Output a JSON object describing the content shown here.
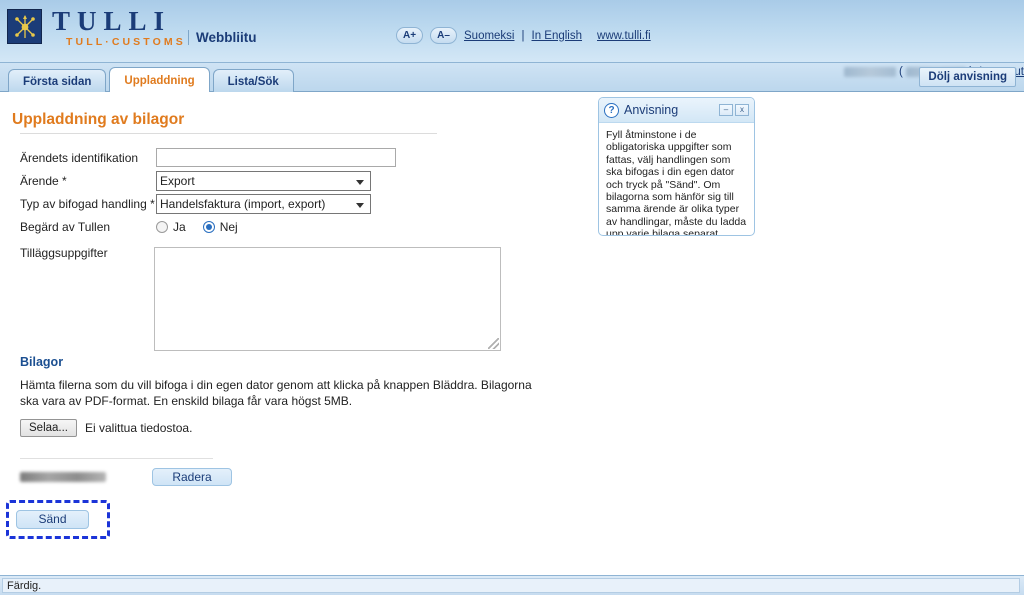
{
  "header": {
    "brand_main": "TULLI",
    "brand_sub": "TULL·CUSTOMS",
    "app_name": "Webbliitu",
    "font_increase": "A+",
    "font_decrease": "A–",
    "lang_fi": "Suomeksi",
    "lang_sep": "|",
    "lang_en": "In English",
    "site_link": "www.tulli.fi"
  },
  "tabs": [
    {
      "label": "Första sidan",
      "active": false
    },
    {
      "label": "Uppladdning",
      "active": true
    },
    {
      "label": "Lista/Sök",
      "active": false
    }
  ],
  "userbar": {
    "open_paren": "(",
    "close_paren": ")",
    "logout": "Logga ut",
    "hide_hint": "Dölj anvisning"
  },
  "page": {
    "title": "Uppladdning av bilagor"
  },
  "form": {
    "fields": [
      {
        "label": "Ärendets identifikation",
        "value": "",
        "type": "text"
      },
      {
        "label": "Ärende *",
        "value": "Export",
        "type": "select"
      },
      {
        "label": "Typ av bifogad handling *",
        "value": "Handelsfaktura (import, export)",
        "type": "select"
      }
    ],
    "radio_label": "Begärd av Tullen",
    "radio_yes": "Ja",
    "radio_no": "Nej",
    "radio_selected": "Nej",
    "textarea_label": "Tilläggsuppgifter",
    "textarea_value": ""
  },
  "attachments": {
    "section_title": "Bilagor",
    "description": "Hämta filerna som du vill bifoga i din egen dator genom att klicka på knappen Bläddra. Bilagorna ska vara av PDF-format. En enskild bilaga får vara högst 5MB.",
    "browse_button": "Selaa...",
    "no_file_text": "Ei valittua tiedostoa.",
    "delete_button": "Radera",
    "send_button": "Sänd"
  },
  "hint_panel": {
    "title": "Anvisning",
    "help_glyph": "?",
    "minimize_glyph": "–",
    "close_glyph": "x",
    "body": "Fyll åtminstone i de obligatoriska uppgifter som fattas, välj handlingen som ska bifogas i din egen dator och tryck på \"Sänd\". Om bilagorna som hänför sig till samma ärende är olika typer av handlingar, måste du ladda upp varje bilaga separat."
  },
  "status": {
    "text": "Färdig."
  },
  "colors": {
    "brand_blue": "#1b3c78",
    "accent_orange": "#e07b1e",
    "header_blue": "#bcd9ef",
    "focus_outline": "#1b34d8"
  }
}
